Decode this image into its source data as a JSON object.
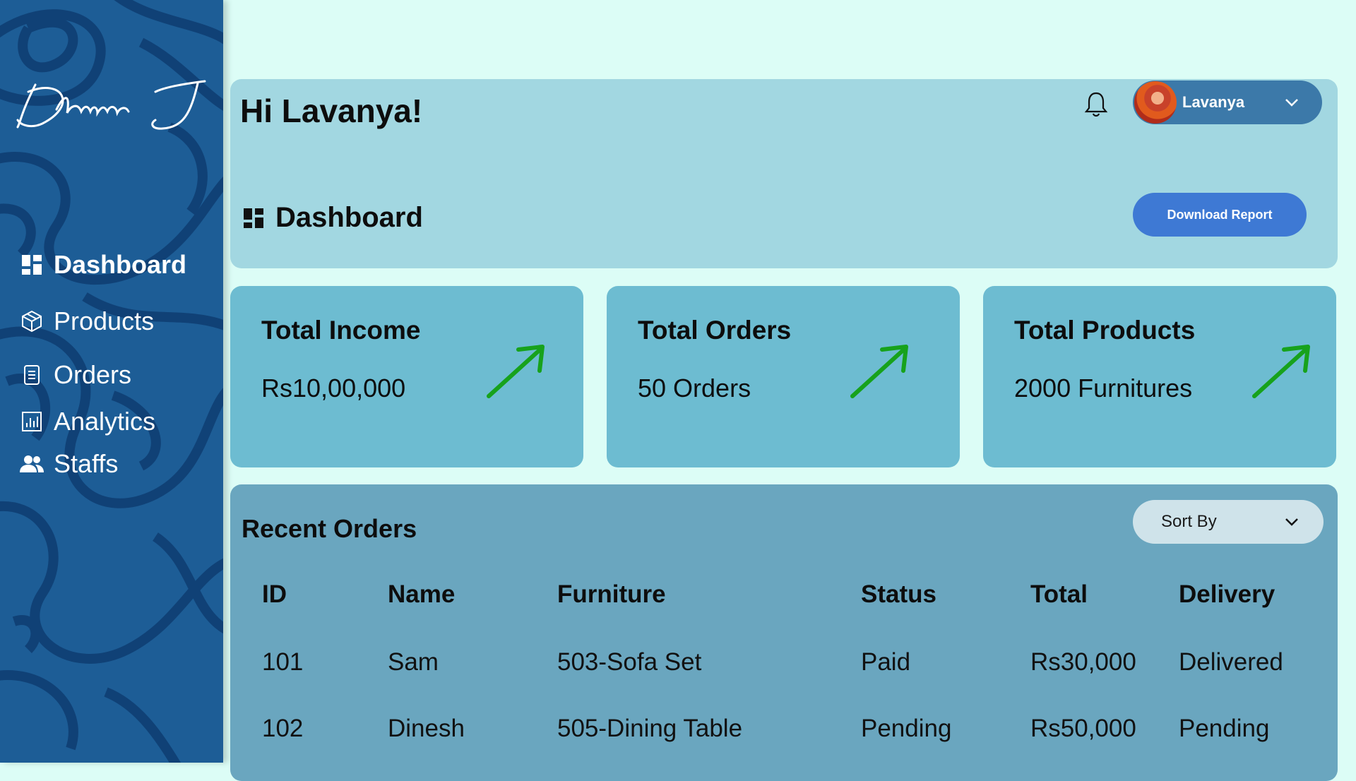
{
  "sidebar": {
    "logo_text": "Dharun J",
    "items": [
      {
        "label": "Dashboard",
        "icon": "dashboard-icon",
        "active": true
      },
      {
        "label": "Products",
        "icon": "box-icon"
      },
      {
        "label": "Orders",
        "icon": "document-icon"
      },
      {
        "label": "Analytics",
        "icon": "chart-icon"
      },
      {
        "label": "Staffs",
        "icon": "users-icon"
      }
    ]
  },
  "header": {
    "greeting": "Hi Lavanya!",
    "user_name": "Lavanya",
    "page_title": "Dashboard",
    "download_label": "Download Report"
  },
  "cards": [
    {
      "title": "Total Income",
      "value": "Rs10,00,000",
      "trend": "up"
    },
    {
      "title": "Total Orders",
      "value": "50 Orders",
      "trend": "up"
    },
    {
      "title": "Total Products",
      "value": "2000 Furnitures",
      "trend": "up"
    }
  ],
  "orders": {
    "title": "Recent Orders",
    "sort_label": "Sort By",
    "columns": [
      "ID",
      "Name",
      "Furniture",
      "Status",
      "Total",
      "Delivery"
    ],
    "rows": [
      [
        "101",
        "Sam",
        "503-Sofa Set",
        "Paid",
        "Rs30,000",
        "Delivered"
      ],
      [
        "102",
        "Dinesh",
        "505-Dining Table",
        "Pending",
        "Rs50,000",
        "Pending"
      ]
    ]
  },
  "colors": {
    "sidebar": "#1d5d96",
    "background": "#dcfdf6",
    "header_panel": "#a2d7e1",
    "card": "#6dbcd1",
    "orders_panel": "#6aa6bf",
    "button": "#3e79d4",
    "trend_up": "#17a21c"
  }
}
